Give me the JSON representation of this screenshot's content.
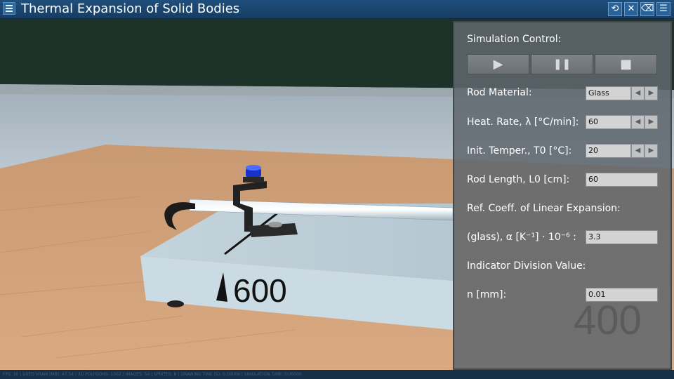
{
  "app": {
    "title": "Thermal Expansion of Solid Bodies"
  },
  "toolbar": {
    "icons": [
      "reset-icon",
      "sound-off-icon",
      "eraser-icon",
      "list-icon"
    ]
  },
  "scene": {
    "ruler_label": "600",
    "ruler_label_far": "400"
  },
  "panel": {
    "simulation_control_label": "Simulation Control:",
    "buttons": {
      "play": "▶",
      "pause": "❚❚",
      "stop": "■"
    },
    "rod_material": {
      "label": "Rod Material:",
      "value": "Glass"
    },
    "heat_rate": {
      "label": "Heat. Rate, λ [°C/min]:",
      "value": "60"
    },
    "init_temp": {
      "label": "Init. Temper., T0 [°C]:",
      "value": "20"
    },
    "rod_length": {
      "label": "Rod Length, L0 [cm]:",
      "value": "60"
    },
    "coeff": {
      "label_line1": "Ref. Coeff. of Linear Expansion:",
      "label_line2": "(glass), α [K⁻¹] · 10⁻⁶ :",
      "value": "3.3"
    },
    "indicator": {
      "label_line1": "Indicator Division Value:",
      "label_line2": "n [mm]:",
      "value": "0.01"
    }
  },
  "status_bar": {
    "text": "FPS: 30 | USED VRAM (MB): 47.54 | 3D POLYGONS: 1002 | IMAGES: 54 | SPRITES: 8 | DRAWING TIME (S): 0.00006 | SIMULATION TIME: 0.00000"
  },
  "colors": {
    "titlebar": "#1f4f7c",
    "panel": "#5f676e",
    "field_bg": "#d3d3d3"
  }
}
